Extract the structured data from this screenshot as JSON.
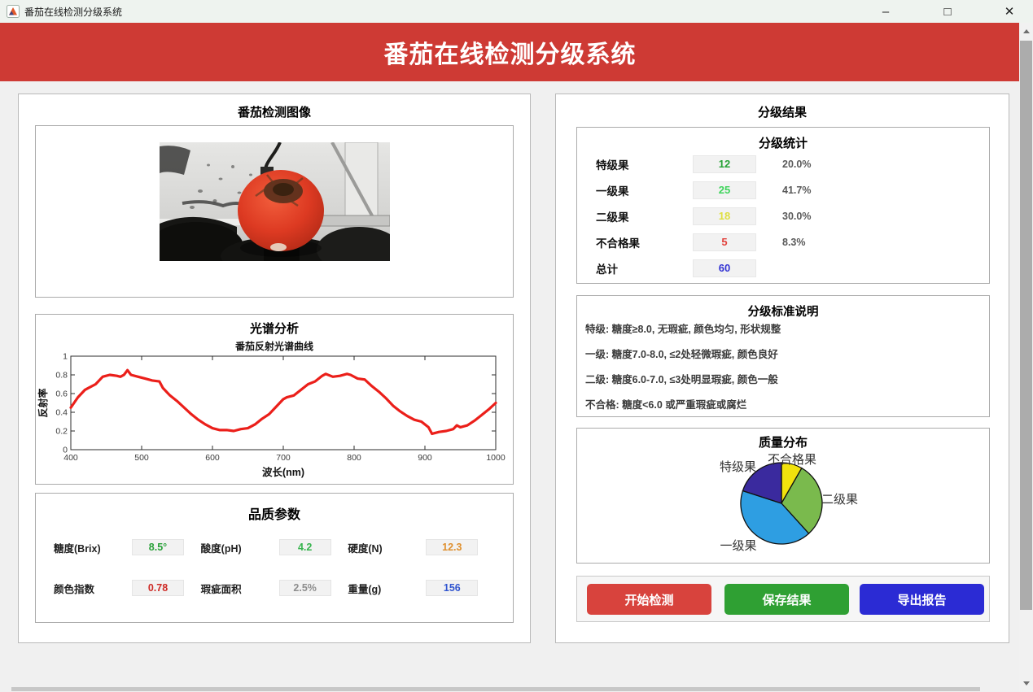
{
  "window": {
    "title": "番茄在线检测分级系统",
    "minimize_glyph": "–",
    "maximize_glyph": "□",
    "close_glyph": "✕"
  },
  "header": {
    "title": "番茄在线检测分级系统",
    "bg": "#CE3A34"
  },
  "left_panel": {
    "image_section": {
      "title": "番茄检测图像"
    },
    "spectrum_section": {
      "title": "光谱分析"
    },
    "quality_section": {
      "title": "品质参数",
      "params": [
        {
          "label": "糖度(Brix)",
          "value": "8.5°",
          "color": "#2AA13A"
        },
        {
          "label": "酸度(pH)",
          "value": "4.2",
          "color": "#37B44E"
        },
        {
          "label": "硬度(N)",
          "value": "12.3",
          "color": "#DF8F2D"
        },
        {
          "label": "颜色指数",
          "value": "0.78",
          "color": "#CE2B26"
        },
        {
          "label": "瑕疵面积",
          "value": "2.5%",
          "color": "#8E8E8E"
        },
        {
          "label": "重量(g)",
          "value": "156",
          "color": "#3256D0"
        }
      ]
    }
  },
  "right_panel": {
    "title": "分级结果",
    "stats": {
      "title": "分级统计",
      "rows": [
        {
          "label": "特级果",
          "value": "12",
          "color": "#26A235",
          "percent": "20.0%"
        },
        {
          "label": "一级果",
          "value": "25",
          "color": "#3FD45C",
          "percent": "41.7%"
        },
        {
          "label": "二级果",
          "value": "18",
          "color": "#DFDF40",
          "percent": "30.0%"
        },
        {
          "label": "不合格果",
          "value": "5",
          "color": "#E2423D",
          "percent": "8.3%"
        },
        {
          "label": "总计",
          "value": "60",
          "color": "#3434D4",
          "percent": ""
        }
      ]
    },
    "standards": {
      "title": "分级标准说明",
      "lines": [
        "特级: 糖度≥8.0, 无瑕疵, 颜色均匀, 形状规整",
        "一级: 糖度7.0-8.0, ≤2处轻微瑕疵, 颜色良好",
        "二级: 糖度6.0-7.0, ≤3处明显瑕疵, 颜色一般",
        "不合格: 糖度<6.0 或严重瑕疵或腐烂"
      ]
    },
    "buttons": [
      {
        "label": "开始检测",
        "color": "#D8433D"
      },
      {
        "label": "保存结果",
        "color": "#2FA033"
      },
      {
        "label": "导出报告",
        "color": "#2B2BD4"
      }
    ]
  },
  "chart_data": [
    {
      "type": "line",
      "title": "番茄反射光谱曲线",
      "xlabel": "波长(nm)",
      "ylabel": "反射率",
      "xlim": [
        400,
        1000
      ],
      "ylim": [
        0,
        1
      ],
      "xticks": [
        400,
        500,
        600,
        700,
        800,
        900,
        1000
      ],
      "yticks": [
        0,
        0.2,
        0.4,
        0.6,
        0.8,
        1
      ],
      "legend": "none",
      "grid": false,
      "line_color": "#EB1F1A",
      "x": [
        400,
        410,
        420,
        425,
        435,
        445,
        455,
        465,
        470,
        475,
        480,
        485,
        495,
        505,
        515,
        525,
        530,
        540,
        550,
        560,
        570,
        580,
        590,
        600,
        610,
        620,
        630,
        640,
        650,
        660,
        670,
        680,
        690,
        700,
        705,
        715,
        725,
        735,
        745,
        755,
        760,
        770,
        780,
        790,
        795,
        805,
        815,
        825,
        835,
        845,
        855,
        865,
        875,
        885,
        895,
        905,
        910,
        920,
        930,
        940,
        945,
        950,
        960,
        970,
        980,
        990,
        1000
      ],
      "y": [
        0.45,
        0.56,
        0.64,
        0.66,
        0.7,
        0.78,
        0.8,
        0.79,
        0.78,
        0.8,
        0.85,
        0.8,
        0.78,
        0.76,
        0.74,
        0.73,
        0.66,
        0.58,
        0.52,
        0.45,
        0.38,
        0.32,
        0.27,
        0.23,
        0.21,
        0.21,
        0.2,
        0.22,
        0.23,
        0.27,
        0.33,
        0.38,
        0.46,
        0.54,
        0.56,
        0.58,
        0.64,
        0.7,
        0.73,
        0.79,
        0.81,
        0.78,
        0.79,
        0.81,
        0.8,
        0.76,
        0.75,
        0.68,
        0.62,
        0.55,
        0.47,
        0.41,
        0.36,
        0.32,
        0.3,
        0.24,
        0.17,
        0.19,
        0.2,
        0.22,
        0.26,
        0.24,
        0.26,
        0.31,
        0.37,
        0.43,
        0.5
      ]
    },
    {
      "type": "pie",
      "title": "质量分布",
      "labels": [
        "不合格果",
        "二级果",
        "一级果",
        "特级果"
      ],
      "values": [
        8.3,
        30.0,
        41.7,
        20.0
      ],
      "colors": [
        "#F1E20D",
        "#7ABA4D",
        "#2E9EE2",
        "#3A2A9E"
      ],
      "start": "top",
      "direction": "clockwise",
      "legend_position": "labels-around-pie"
    }
  ]
}
